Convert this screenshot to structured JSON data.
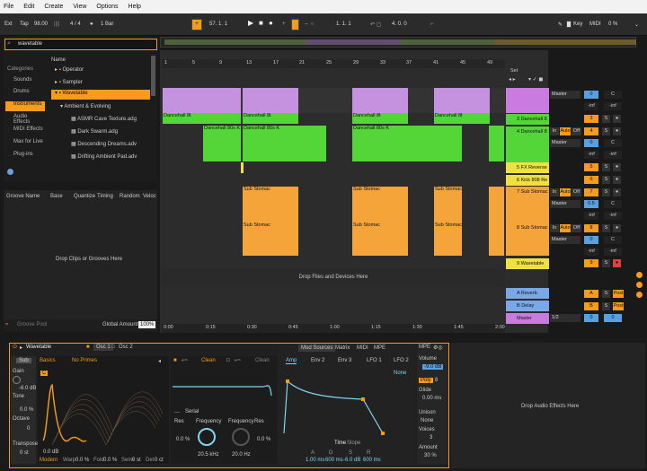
{
  "menu": [
    "File",
    "Edit",
    "Create",
    "View",
    "Options",
    "Help"
  ],
  "transport": {
    "ext": "Ext",
    "tap": "Tap",
    "bpm": "98.00",
    "sig": "4 / 4",
    "bar": "1 Bar",
    "pos": "57.  1.  1",
    "loop_start": "1.  1.  1",
    "loop_len": "4.  0.  0",
    "key": "Key",
    "midi": "MIDI",
    "cpu": "0 %"
  },
  "browser": {
    "search": "wavetable",
    "categories_header": "Categories",
    "categories": [
      "Sounds",
      "Drums",
      "Instruments",
      "Audio Effects",
      "MIDI Effects",
      "Max for Live",
      "Plug-ins"
    ],
    "name_header": "Name",
    "items": [
      "Operator",
      "Sampler",
      "Wavetable",
      "Ambient & Evolving",
      "ASMR Cave Texture.adg",
      "Dark Swarm.adg",
      "Descending Dreams.adv",
      "Drifting Ambient Pad.adv"
    ]
  },
  "groove": {
    "headers": [
      "Groove Name",
      "Base",
      "Quantize",
      "Timing",
      "Random",
      "Veloc"
    ],
    "drop": "Drop Clips or Grooves Here",
    "pool": "Groove Pool",
    "global_label": "Global Amount",
    "global_value": "100%"
  },
  "ruler": [
    "1",
    "5",
    "9",
    "13",
    "17",
    "21",
    "25",
    "29",
    "33",
    "37",
    "41",
    "45",
    "49"
  ],
  "time_ruler": [
    "0:00",
    "0:15",
    "0:30",
    "0:45",
    "1:00",
    "1:15",
    "1:30",
    "1:45",
    "2:00"
  ],
  "drop_files": "Drop Files and Devices Here",
  "set": "Set",
  "tracks": [
    {
      "name": "3 Dancehall 8",
      "color": "#55d638",
      "clip": "Dancehall 8t"
    },
    {
      "name": "4 Dancehall 8",
      "color": "#55d638",
      "clip": "Dancehall 80s K"
    },
    {
      "name": "5 FX Reverse",
      "color": "#f0e040"
    },
    {
      "name": "6 Kick 808 Re",
      "color": "#f0e040"
    },
    {
      "name": "7 Sub Stomac",
      "color": "#f5a43a",
      "clip": "Sub Stomac"
    },
    {
      "name": "8 Sub Stomac",
      "color": "#f5a43a",
      "clip": "Sub Stomac"
    },
    {
      "name": "9 Wavetable",
      "color": "#f0e040"
    },
    {
      "name": "A Reverb",
      "color": "#7aa7e8"
    },
    {
      "name": "B Delay",
      "color": "#7aa7e8"
    },
    {
      "name": "Master",
      "color": "#c97be0"
    }
  ],
  "mixer": {
    "master": "Master",
    "in": "In",
    "auto": "Auto",
    "off": "Off",
    "s": "S",
    "c": "C",
    "inf": "-inf",
    "post": "Post",
    "half": "1/2",
    "zero": "0",
    "vals": [
      "0",
      "3",
      "4",
      "5",
      "6",
      "7",
      "8",
      "9",
      "A",
      "B",
      "0"
    ],
    "pan": "0.5"
  },
  "device": {
    "title": "Wavetable",
    "osc1": "Osc 1",
    "osc2": "Osc 2",
    "sub": "Sub",
    "gain": "Gain",
    "gain_v": "-6.0 dB",
    "tone": "Tone",
    "tone_v": "0.0 %",
    "octave": "Octave",
    "oct_v": "0",
    "transpose": "Transpose",
    "trans_v": "0 st",
    "basics": "Basics",
    "noprimes": "No Primes",
    "modern": "Modern",
    "warp": "Warp",
    "warp_v": "0.0 %",
    "fold": "Fold",
    "fold_v": "0.0 %",
    "semi": "Semi",
    "semi_v": "0 st",
    "det": "Det",
    "det_v": "0 ct",
    "db0": "0.0 dB",
    "c": "C",
    "filter_clean": "Clean",
    "serial": "Serial",
    "res": "Res",
    "freq": "Frequency",
    "res_v": "0.0 %",
    "freq_v": "20.5 kHz",
    "freq2_v": "20.0 Hz",
    "res2_v": "0.0 %",
    "mod_tabs": [
      "Mod Sources",
      "Matrix",
      "MIDI",
      "MPE"
    ],
    "env_tabs": [
      "Amp",
      "Env 2",
      "Env 3",
      "LFO 1",
      "LFO 2"
    ],
    "none": "None",
    "time": "Time",
    "slope": "Slope",
    "adsr_labels": [
      "A",
      "D",
      "S",
      "R"
    ],
    "adsr_vals": [
      "1.00 ms",
      "600 ms",
      "-6.0 dB",
      "600 ms"
    ],
    "mpe": "MPE",
    "volume": "Volume",
    "volume_v": "-9.0 dB",
    "poly": "Poly",
    "poly_v": "8",
    "glide": "Glide",
    "glide_v": "0.00 ms",
    "unison": "Unison",
    "unison_v": "None",
    "voices": "Voices",
    "voices_v": "3",
    "amount": "Amount",
    "amount_v": "30 %",
    "drop_audio": "Drop Audio Effects Here"
  }
}
